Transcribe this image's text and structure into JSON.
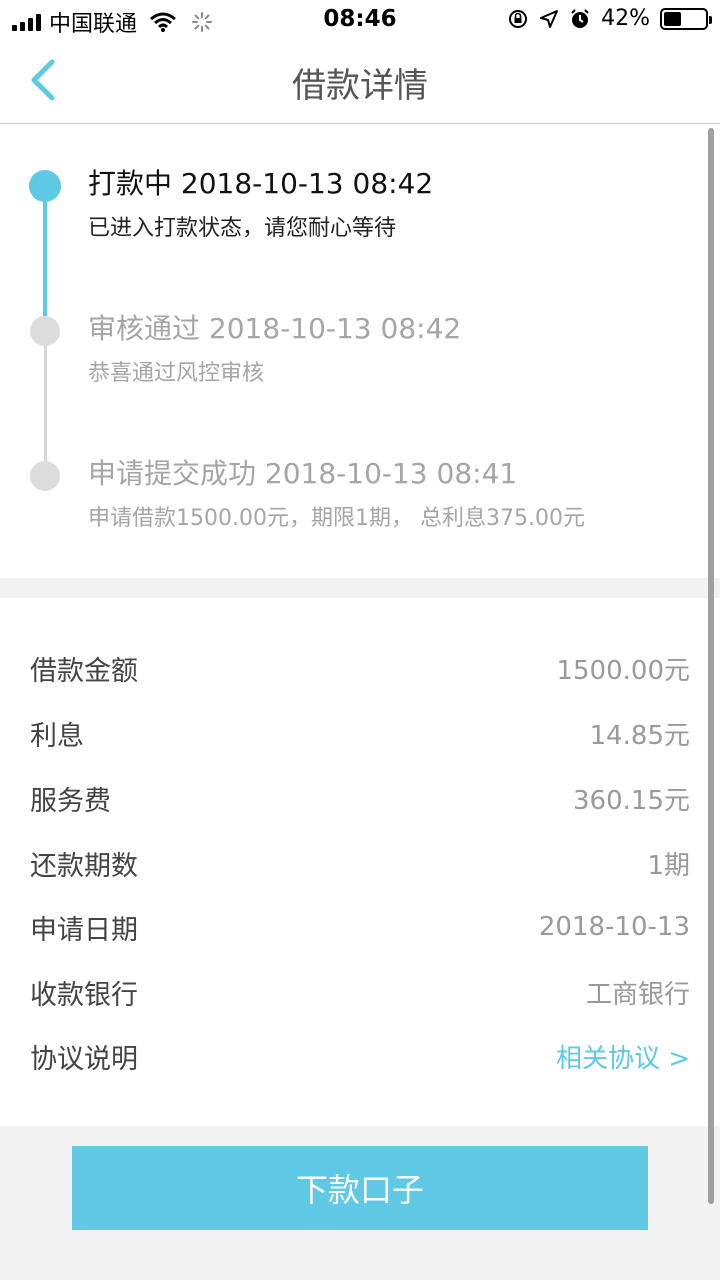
{
  "status_bar": {
    "carrier": "中国联通",
    "time": "08:46",
    "battery": "42%",
    "battery_level": 0.42
  },
  "nav": {
    "title": "借款详情"
  },
  "timeline": [
    {
      "title": "打款中 2018-10-13 08:42",
      "desc": "已进入打款状态，请您耐心等待",
      "state": "active"
    },
    {
      "title": "审核通过 2018-10-13 08:42",
      "desc": "恭喜通过风控审核",
      "state": "done"
    },
    {
      "title": "申请提交成功 2018-10-13 08:41",
      "desc": "申请借款1500.00元，期限1期，  总利息375.00元",
      "state": "done"
    }
  ],
  "details": [
    {
      "label": "借款金额",
      "value": "1500.00元"
    },
    {
      "label": "利息",
      "value": "14.85元"
    },
    {
      "label": "服务费",
      "value": "360.15元"
    },
    {
      "label": "还款期数",
      "value": "1期"
    },
    {
      "label": "申请日期",
      "value": "2018-10-13"
    },
    {
      "label": "收款银行",
      "value": "工商银行"
    },
    {
      "label": "协议说明",
      "value": "相关协议 >"
    }
  ],
  "footer": {
    "button_label": "下款口子"
  },
  "colors": {
    "accent": "#5ec8e5",
    "muted": "#a5a5a5"
  }
}
